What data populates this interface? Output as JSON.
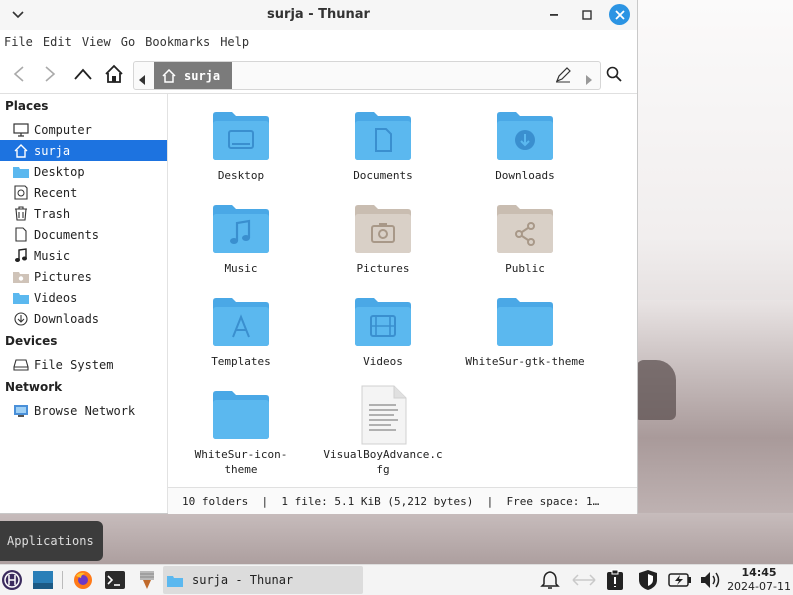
{
  "window": {
    "title": "surja - Thunar"
  },
  "menu": [
    "File",
    "Edit",
    "View",
    "Go",
    "Bookmarks",
    "Help"
  ],
  "pathbar": {
    "current": "surja"
  },
  "sidebar": {
    "sections": [
      {
        "heading": "Places",
        "items": [
          {
            "label": "Computer",
            "icon": "computer-icon"
          },
          {
            "label": "surja",
            "icon": "home-icon",
            "selected": true
          },
          {
            "label": "Desktop",
            "icon": "desktop-folder-icon"
          },
          {
            "label": "Recent",
            "icon": "recent-icon"
          },
          {
            "label": "Trash",
            "icon": "trash-icon"
          },
          {
            "label": "Documents",
            "icon": "document-icon"
          },
          {
            "label": "Music",
            "icon": "music-icon"
          },
          {
            "label": "Pictures",
            "icon": "pictures-icon"
          },
          {
            "label": "Videos",
            "icon": "videos-icon"
          },
          {
            "label": "Downloads",
            "icon": "downloads-icon"
          }
        ]
      },
      {
        "heading": "Devices",
        "items": [
          {
            "label": "File System",
            "icon": "drive-icon"
          }
        ]
      },
      {
        "heading": "Network",
        "items": [
          {
            "label": "Browse Network",
            "icon": "network-icon"
          }
        ]
      }
    ]
  },
  "files": [
    {
      "name": "Desktop",
      "type": "folder",
      "emblem": "desktop"
    },
    {
      "name": "Documents",
      "type": "folder",
      "emblem": "document"
    },
    {
      "name": "Downloads",
      "type": "folder",
      "emblem": "download"
    },
    {
      "name": "Music",
      "type": "folder",
      "emblem": "music"
    },
    {
      "name": "Pictures",
      "type": "folder-beige",
      "emblem": "camera"
    },
    {
      "name": "Public",
      "type": "folder-beige",
      "emblem": "share"
    },
    {
      "name": "Templates",
      "type": "folder",
      "emblem": "template"
    },
    {
      "name": "Videos",
      "type": "folder",
      "emblem": "film"
    },
    {
      "name": "WhiteSur-gtk-theme",
      "type": "folder",
      "emblem": ""
    },
    {
      "name": "WhiteSur-icon-\ntheme",
      "type": "folder",
      "emblem": ""
    },
    {
      "name": "VisualBoyAdvance.c\nfg",
      "type": "text-file",
      "emblem": ""
    }
  ],
  "status": {
    "folders": "10 folders",
    "file": "1 file: 5.1 KiB (5,212 bytes)",
    "free": "Free space: 1…"
  },
  "applications_tooltip": "Applications",
  "taskbar": {
    "window_label": "surja - Thunar",
    "time": "14:45",
    "date": "2024-07-11"
  },
  "colors": {
    "folder_blue": "#5bb8ef",
    "folder_beige": "#d6cdc4",
    "selection": "#1d73e0",
    "close_button": "#2b94e3"
  }
}
